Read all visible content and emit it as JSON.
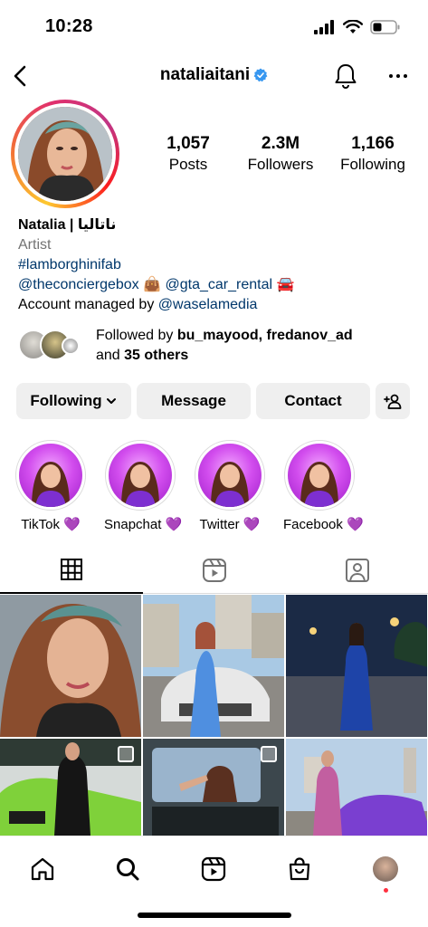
{
  "status_bar": {
    "time": "10:28"
  },
  "header": {
    "username": "nataliaitani"
  },
  "stats": {
    "posts_value": "1,057",
    "posts_label": "Posts",
    "followers_value": "2.3M",
    "followers_label": "Followers",
    "following_value": "1,166",
    "following_label": "Following"
  },
  "bio": {
    "name": "Natalia | ناتاليا",
    "category": "Artist",
    "hashtag": "#lamborghinifab",
    "link1": "@theconciergebox",
    "link1_emoji": "👜",
    "link2": "@gta_car_rental",
    "link2_emoji": "🚘",
    "managed_prefix": "Account managed by ",
    "managed_link": "@waselamedia"
  },
  "followed_by": {
    "prefix": "Followed by ",
    "user1": "bu_mayood",
    "separator": ", ",
    "user2": "fredanov_ad",
    "and": "and ",
    "others": "35 others"
  },
  "actions": {
    "following": "Following",
    "message": "Message",
    "contact": "Contact"
  },
  "highlights": [
    {
      "label": "TikTok 💜"
    },
    {
      "label": "Snapchat 💜"
    },
    {
      "label": "Twitter 💜"
    },
    {
      "label": "Facebook 💜"
    }
  ],
  "colors": {
    "link": "#00376b",
    "verified": "#3797f0",
    "button_bg": "#efefef",
    "notification_dot": "#ff3040"
  },
  "icons": [
    "back-icon",
    "verified-icon",
    "bell-icon",
    "more-icon",
    "add-person-icon",
    "grid-icon",
    "reels-icon",
    "tagged-icon",
    "home-icon",
    "search-icon",
    "shop-icon"
  ]
}
